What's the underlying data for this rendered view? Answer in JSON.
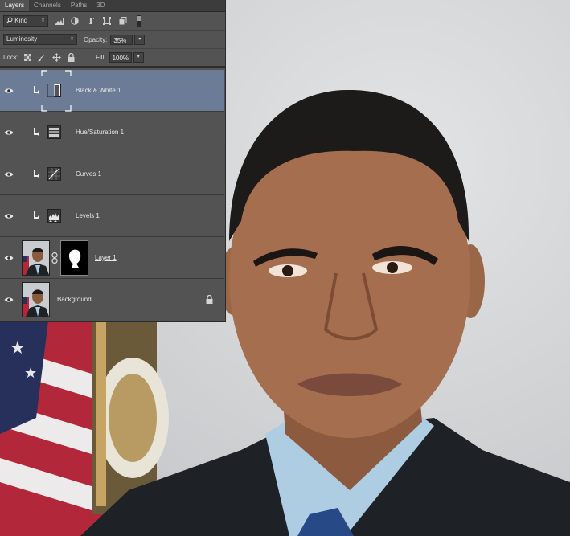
{
  "panel": {
    "tabs": [
      "Layers",
      "Channels",
      "Paths",
      "3D"
    ],
    "active_tab": "Layers",
    "filter_kind": "Kind",
    "blend_mode": "Luminosity",
    "opacity_label": "Opacity:",
    "opacity_value": "35%",
    "lock_label": "Lock:",
    "fill_label": "Fill:",
    "fill_value": "100%"
  },
  "layers": [
    {
      "name": "Black & White 1",
      "type": "adjustment",
      "icon": "black-white-icon",
      "clipped": true,
      "selected": true,
      "visible": true
    },
    {
      "name": "Hue/Saturation 1",
      "type": "adjustment",
      "icon": "hue-saturation-icon",
      "clipped": true,
      "selected": false,
      "visible": true
    },
    {
      "name": "Curves 1",
      "type": "adjustment",
      "icon": "curves-icon",
      "clipped": true,
      "selected": false,
      "visible": true
    },
    {
      "name": "Levels 1",
      "type": "adjustment",
      "icon": "levels-icon",
      "clipped": true,
      "selected": false,
      "visible": true
    },
    {
      "name": "Layer 1",
      "type": "pixel-with-mask",
      "icon": "photo-thumbnail",
      "clipped": false,
      "selected": false,
      "visible": true
    },
    {
      "name": "Background",
      "type": "background",
      "icon": "photo-thumbnail",
      "locked": true,
      "selected": false,
      "visible": true
    }
  ],
  "colors": {
    "panel_bg": "#535353",
    "selected_layer": "#6c7c96",
    "tab_bar": "#3c3c3c"
  }
}
